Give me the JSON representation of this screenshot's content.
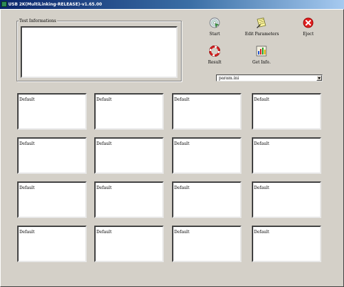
{
  "window": {
    "title": "USB 2K(MultiLinking-RELEASE)-v1.65.00"
  },
  "test_info": {
    "label": "Test Informations",
    "value": ""
  },
  "toolbar": {
    "start_label": "Start",
    "edit_label": "Edit Parameters",
    "eject_label": "Eject",
    "result_label": "Result",
    "getinfo_label": "Get Info."
  },
  "param_select": {
    "value": "param.ini"
  },
  "slots": [
    "Default",
    "Default",
    "Default",
    "Default",
    "Default",
    "Default",
    "Default",
    "Default",
    "Default",
    "Default",
    "Default",
    "Default",
    "Default",
    "Default",
    "Default",
    "Default"
  ],
  "colors": {
    "titlebar_start": "#0a246a",
    "titlebar_end": "#a6caf0",
    "face": "#d4d0c8"
  }
}
